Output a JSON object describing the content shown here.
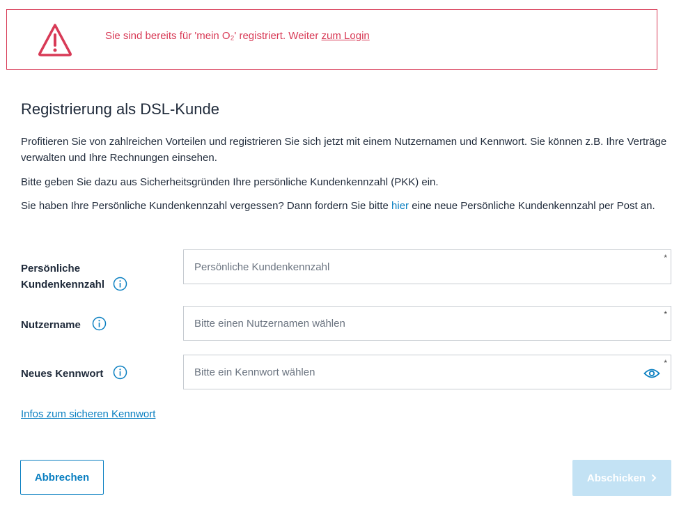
{
  "alert": {
    "message": "Sie sind bereits für 'mein O₂' registriert. Weiter ",
    "link_label": "zum Login",
    "color": "#d83a56",
    "icon": "warning-triangle-icon"
  },
  "page": {
    "title": "Registrierung als DSL-Kunde",
    "intro": "Profitieren Sie von zahlreichen Vorteilen und registrieren Sie sich jetzt mit einem Nutzernamen und Kennwort. Sie können z.B. Ihre Verträge verwalten und Ihre Rechnungen einsehen.",
    "pkk_hint": "Bitte geben Sie dazu aus Sicherheitsgründen Ihre persönliche Kundenkennzahl (PKK) ein.",
    "forgot_prefix": "Sie haben Ihre Persönliche Kundenkennzahl vergessen? Dann fordern Sie bitte ",
    "forgot_link": "hier",
    "forgot_suffix": " eine neue Persönliche Kundenkennzahl per Post an."
  },
  "form": {
    "pkk": {
      "label_line1": "Persönliche",
      "label_line2": "Kundenkennzahl",
      "placeholder": "Persönliche Kundenkennzahl",
      "value": "",
      "required_mark": "*"
    },
    "username": {
      "label": "Nutzername",
      "placeholder": "Bitte einen Nutzernamen wählen",
      "value": "",
      "required_mark": "*"
    },
    "password": {
      "label": "Neues Kennwort",
      "placeholder": "Bitte ein Kennwort wählen",
      "value": "",
      "required_mark": "*"
    },
    "password_info_link": "Infos zum sicheren Kennwort"
  },
  "actions": {
    "cancel_label": "Abbrechen",
    "submit_label": "Abschicken"
  },
  "colors": {
    "accent": "#0a7fc1",
    "error": "#d83a56",
    "submit_disabled": "#c3e2f4"
  }
}
